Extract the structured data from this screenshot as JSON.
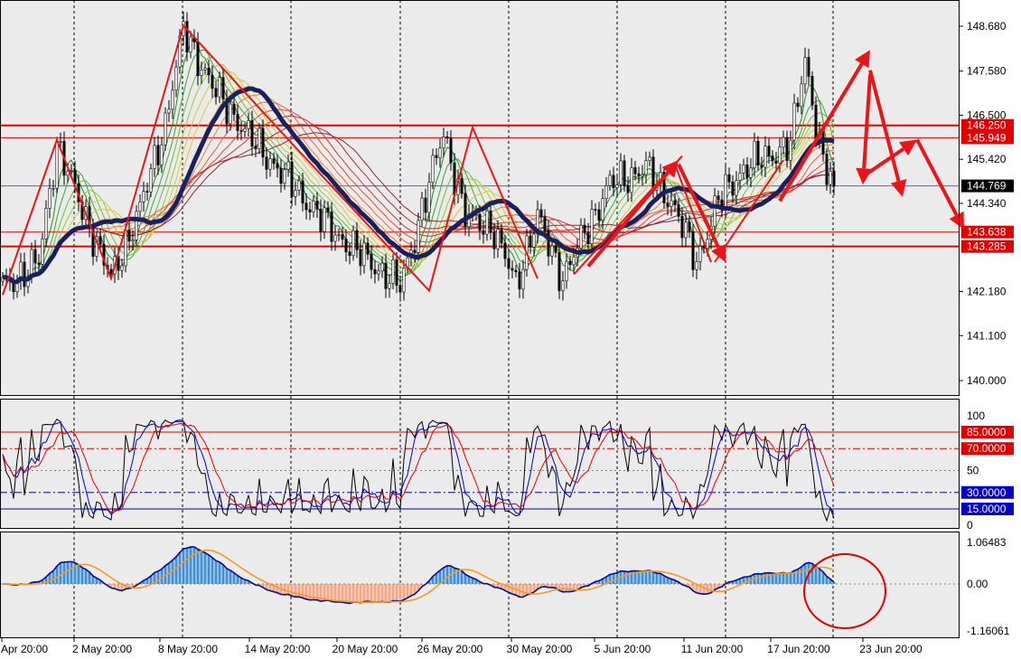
{
  "chart_data": [
    {
      "type": "line",
      "panel": "price",
      "xlabel": "",
      "ylabel": "",
      "x_labels": [
        "Apr 20:00",
        "2 May 20:00",
        "8 May 20:00",
        "14 May 20:00",
        "20 May 20:00",
        "26 May 20:00",
        "30 May 20:00",
        "5 Jun 20:00",
        "11 Jun 20:00",
        "17 Jun 20:00",
        "23 Jun 20:00"
      ],
      "y_ticks": [
        "148.680",
        "147.580",
        "146.500",
        "145.420",
        "144.340",
        "142.180",
        "141.100",
        "140.000"
      ],
      "ylim": [
        140.0,
        148.68
      ],
      "grid": "vertical dashed",
      "bar_count": 230,
      "current_price": "144.769",
      "horizontal_levels": [
        {
          "value": 146.25,
          "label": "146.250",
          "color": "#e00000"
        },
        {
          "value": 145.949,
          "label": "145.949",
          "color": "#e00000"
        },
        {
          "value": 143.638,
          "label": "143.638",
          "color": "#e00000"
        },
        {
          "value": 143.285,
          "label": "143.285",
          "color": "#e00000"
        }
      ],
      "close_anchors": [
        [
          0,
          142.3
        ],
        [
          10,
          142.9
        ],
        [
          15,
          145.8
        ],
        [
          22,
          144.2
        ],
        [
          30,
          142.5
        ],
        [
          38,
          144.2
        ],
        [
          45,
          146.3
        ],
        [
          50,
          148.6
        ],
        [
          58,
          147.2
        ],
        [
          68,
          146.0
        ],
        [
          78,
          145.0
        ],
        [
          92,
          143.6
        ],
        [
          110,
          142.3
        ],
        [
          118,
          144.8
        ],
        [
          122,
          146.1
        ],
        [
          128,
          144.0
        ],
        [
          135,
          143.8
        ],
        [
          142,
          142.4
        ],
        [
          148,
          144.0
        ],
        [
          155,
          142.5
        ],
        [
          162,
          143.8
        ],
        [
          168,
          144.8
        ],
        [
          178,
          145.2
        ],
        [
          185,
          144.4
        ],
        [
          192,
          142.9
        ],
        [
          198,
          144.4
        ],
        [
          205,
          145.2
        ],
        [
          212,
          145.5
        ],
        [
          218,
          145.8
        ],
        [
          222,
          147.9
        ],
        [
          227,
          145.3
        ],
        [
          230,
          144.77
        ]
      ],
      "series": [
        {
          "role": "close"
        },
        {
          "role": "ma-fan",
          "periods": [
            5,
            8,
            11,
            14,
            17,
            20,
            24,
            28,
            32,
            36,
            40,
            45,
            50
          ]
        },
        {
          "role": "ma-main",
          "period": 25
        }
      ],
      "annotations": [
        {
          "kind": "zigzag",
          "points": [
            [
              0,
              142.1
            ],
            [
              15,
              145.9
            ],
            [
              30,
              142.5
            ],
            [
              50,
              148.7
            ],
            [
              78,
              146.0
            ],
            [
              118,
              142.2
            ],
            [
              130,
              146.2
            ],
            [
              148,
              142.5
            ]
          ]
        },
        {
          "kind": "line",
          "points": [
            [
              158,
              142.6
            ],
            [
              188,
              145.5
            ]
          ]
        },
        {
          "kind": "line",
          "points": [
            [
              186,
              145.3
            ],
            [
              196,
              142.9
            ]
          ]
        },
        {
          "kind": "line",
          "points": [
            [
              197,
              142.9
            ],
            [
              216,
              145.4
            ]
          ]
        },
        {
          "kind": "arrow",
          "from": [
            162,
            142.8
          ],
          "to": [
            187,
            145.4
          ]
        },
        {
          "kind": "arrow",
          "from": [
            187,
            145.3
          ],
          "to": [
            200,
            142.9
          ]
        },
        {
          "kind": "arrow",
          "from": [
            215,
            144.4
          ],
          "to": [
            240,
            148.1
          ]
        },
        {
          "kind": "arrow",
          "from": [
            240,
            147.5
          ],
          "to": [
            238,
            144.8
          ]
        },
        {
          "kind": "arrow",
          "from": [
            240,
            147.6
          ],
          "to": [
            249,
            144.5
          ]
        },
        {
          "kind": "arrow",
          "from": [
            238,
            145.0
          ],
          "to": [
            253,
            145.9
          ]
        },
        {
          "kind": "arrow",
          "from": [
            253,
            145.9
          ],
          "to": [
            266,
            143.7
          ]
        }
      ]
    },
    {
      "type": "line",
      "panel": "oscillator",
      "ylim": [
        0,
        100
      ],
      "y_ticks": [
        "100",
        "50",
        "0"
      ],
      "levels": [
        {
          "value": 85,
          "label": "85.0000",
          "color": "#e00000"
        },
        {
          "value": 70,
          "label": "70.0000",
          "color": "#e00000"
        },
        {
          "value": 30,
          "label": "30.0000",
          "color": "#0000c8"
        },
        {
          "value": 15,
          "label": "15.0000",
          "color": "#0000c8"
        }
      ],
      "series": [
        {
          "color": "#000000",
          "smoothing": 1
        },
        {
          "color": "#0000cc",
          "smoothing": 4
        },
        {
          "color": "#e00000",
          "smoothing": 9
        }
      ]
    },
    {
      "type": "bar",
      "panel": "macd",
      "ylim": [
        -1.16061,
        1.06483
      ],
      "y_ticks": [
        "1.06483",
        "0.00",
        "-1.16061"
      ],
      "series": [
        {
          "role": "histogram-positive",
          "color": "#3d8fd6"
        },
        {
          "role": "histogram-negative",
          "color": "#f4a582"
        },
        {
          "role": "macd-line",
          "color": "#0a0a8c"
        },
        {
          "role": "signal-line",
          "color": "#f59a23"
        }
      ],
      "annotations": [
        {
          "kind": "circle",
          "color": "#e00000",
          "around_bar": 233
        }
      ]
    }
  ]
}
